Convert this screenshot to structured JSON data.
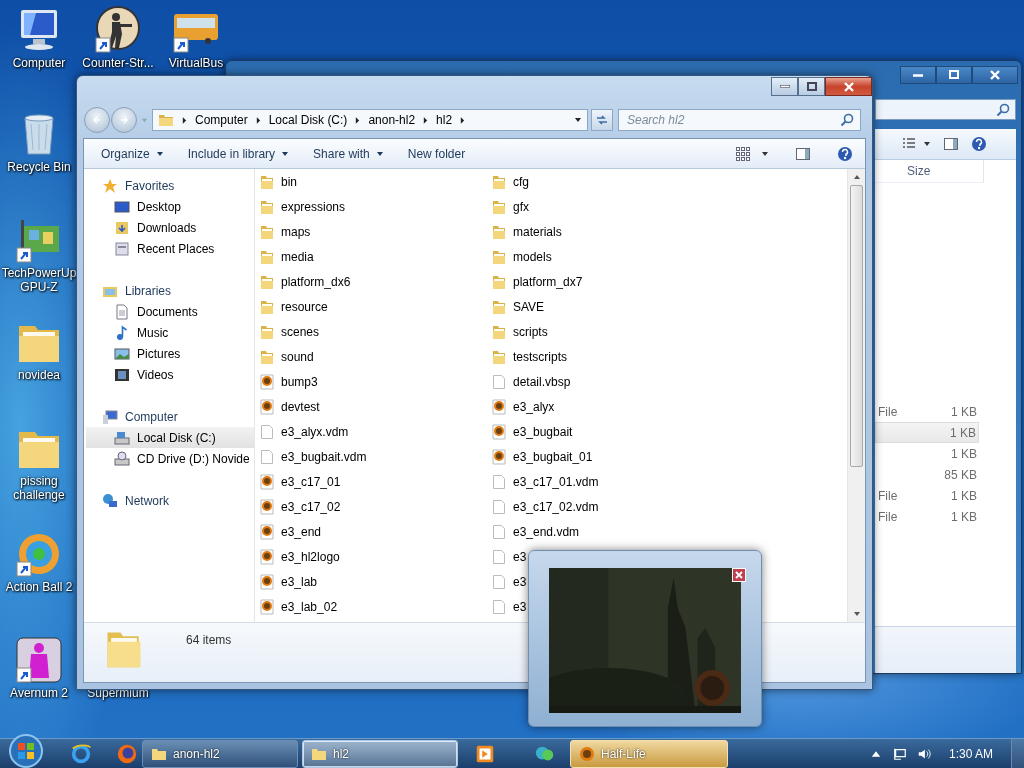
{
  "desktop_icons": [
    {
      "label": "Computer",
      "shortcut": false
    },
    {
      "label": "Counter-Str...",
      "shortcut": true
    },
    {
      "label": "VirtualBus",
      "shortcut": true
    },
    {
      "label": "Recycle Bin",
      "shortcut": false
    },
    {
      "label": "TechPowerUp GPU-Z",
      "shortcut": true
    },
    {
      "label": "novidea",
      "shortcut": false
    },
    {
      "label": "pissing challenge",
      "shortcut": false
    },
    {
      "label": "Action Ball 2",
      "shortcut": true
    },
    {
      "label": "Avernum 2",
      "shortcut": true
    },
    {
      "label": "Supermium"
    }
  ],
  "back_window": {
    "columns": [
      "Size"
    ],
    "rows": [
      {
        "type": "File",
        "size": "1 KB",
        "selected": false
      },
      {
        "size": "1 KB",
        "selected": true
      },
      {
        "size": "1 KB",
        "selected": false
      },
      {
        "size": "85 KB",
        "selected": false
      },
      {
        "type": "File",
        "size": "1 KB",
        "selected": false
      },
      {
        "type": "File",
        "size": "1 KB",
        "selected": false
      }
    ]
  },
  "window": {
    "address": [
      "Computer",
      "Local Disk (C:)",
      "anon-hl2",
      "hl2"
    ],
    "search": {
      "placeholder": "Search hl2"
    },
    "toolbar": [
      {
        "label": "Organize",
        "dropdown": true
      },
      {
        "label": "Include in library",
        "dropdown": true
      },
      {
        "label": "Share with",
        "dropdown": true
      },
      {
        "label": "New folder",
        "dropdown": false
      }
    ],
    "nav": [
      {
        "label": "Favorites",
        "selected": false,
        "children": [
          {
            "label": "Desktop",
            "selected": false
          },
          {
            "label": "Downloads",
            "selected": false
          },
          {
            "label": "Recent Places",
            "selected": false
          }
        ]
      },
      {
        "label": "Libraries",
        "selected": false,
        "children": [
          {
            "label": "Documents",
            "selected": false
          },
          {
            "label": "Music",
            "selected": false
          },
          {
            "label": "Pictures",
            "selected": false
          },
          {
            "label": "Videos",
            "selected": false
          }
        ]
      },
      {
        "label": "Computer",
        "selected": false,
        "children": [
          {
            "label": "Local Disk (C:)",
            "selected": true
          },
          {
            "label": "CD Drive (D:) Novide",
            "selected": false
          }
        ]
      },
      {
        "label": "Network",
        "selected": false
      }
    ],
    "files": [
      {
        "name": "bin",
        "kind": "folder"
      },
      {
        "name": "expressions",
        "kind": "folder"
      },
      {
        "name": "maps",
        "kind": "folder"
      },
      {
        "name": "media",
        "kind": "folder"
      },
      {
        "name": "platform_dx6",
        "kind": "folder"
      },
      {
        "name": "resource",
        "kind": "folder"
      },
      {
        "name": "scenes",
        "kind": "folder"
      },
      {
        "name": "sound",
        "kind": "folder"
      },
      {
        "name": "bump3",
        "kind": "game"
      },
      {
        "name": "devtest",
        "kind": "game"
      },
      {
        "name": "e3_alyx.vdm",
        "kind": "doc"
      },
      {
        "name": "e3_bugbait.vdm",
        "kind": "doc"
      },
      {
        "name": "e3_c17_01",
        "kind": "game"
      },
      {
        "name": "e3_c17_02",
        "kind": "game"
      },
      {
        "name": "e3_end",
        "kind": "game"
      },
      {
        "name": "e3_hl2logo",
        "kind": "game"
      },
      {
        "name": "e3_lab",
        "kind": "game"
      },
      {
        "name": "e3_lab_02",
        "kind": "game"
      },
      {
        "name": "cfg",
        "kind": "folder"
      },
      {
        "name": "gfx",
        "kind": "folder"
      },
      {
        "name": "materials",
        "kind": "folder"
      },
      {
        "name": "models",
        "kind": "folder"
      },
      {
        "name": "platform_dx7",
        "kind": "folder"
      },
      {
        "name": "SAVE",
        "kind": "folder"
      },
      {
        "name": "scripts",
        "kind": "folder"
      },
      {
        "name": "testscripts",
        "kind": "folder"
      },
      {
        "name": "detail.vbsp",
        "kind": "doc"
      },
      {
        "name": "e3_alyx",
        "kind": "game"
      },
      {
        "name": "e3_bugbait",
        "kind": "game"
      },
      {
        "name": "e3_bugbait_01",
        "kind": "game"
      },
      {
        "name": "e3_c17_01.vdm",
        "kind": "doc"
      },
      {
        "name": "e3_c17_02.vdm",
        "kind": "doc"
      },
      {
        "name": "e3_end.vdm",
        "kind": "doc"
      },
      {
        "name": "e3",
        "kind": "doc"
      },
      {
        "name": "e3",
        "kind": "doc"
      },
      {
        "name": "e3",
        "kind": "doc"
      }
    ],
    "status": "64 items"
  },
  "taskbar": {
    "buttons": [
      {
        "label": "anon-hl2",
        "kind": "folder",
        "selected": false,
        "hovered": false
      },
      {
        "label": "hl2",
        "kind": "folder",
        "selected": true,
        "hovered": false
      },
      {
        "label": "Half-Life",
        "kind": "game",
        "selected": false,
        "hovered": true
      }
    ],
    "clock": "1:30 AM"
  }
}
